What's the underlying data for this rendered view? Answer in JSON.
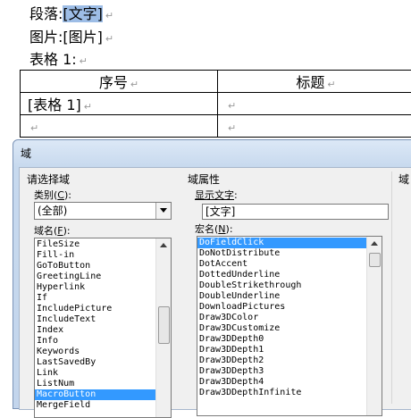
{
  "document": {
    "line1_label": "段落:",
    "line1_value": "[文字]",
    "line2": "图片:[图片]",
    "line3": "表格 1:",
    "paragraph_mark": "↵",
    "table": {
      "headers": [
        "序号",
        "标题"
      ],
      "rows": [
        [
          "[表格 1]",
          ""
        ],
        [
          "",
          ""
        ]
      ]
    }
  },
  "dialog": {
    "title": "域",
    "left_group": "请选择域",
    "category_label": "类别",
    "category_key": "C",
    "category_value": "(全部)",
    "field_names_label": "域名",
    "field_names_key": "F",
    "field_names": [
      "FileSize",
      "Fill-in",
      "GoToButton",
      "GreetingLine",
      "Hyperlink",
      "If",
      "IncludePicture",
      "IncludeText",
      "Index",
      "Info",
      "Keywords",
      "LastSavedBy",
      "Link",
      "ListNum",
      "MacroButton",
      "MergeField"
    ],
    "field_names_selected": 14,
    "right_group": "域属性",
    "display_text_label": "显示文字",
    "display_text_value": "[文字]",
    "macro_label": "宏名",
    "macro_key": "N",
    "macro_names": [
      "DoFieldClick",
      "DoNotDistribute",
      "DotAccent",
      "DottedUnderline",
      "DoubleStrikethrough",
      "DoubleUnderline",
      "DownloadPictures",
      "Draw3DColor",
      "Draw3DCustomize",
      "Draw3DDepth0",
      "Draw3DDepth1",
      "Draw3DDepth2",
      "Draw3DDepth3",
      "Draw3DDepth4",
      "Draw3DDepthInfinite"
    ],
    "macro_selected": 0,
    "third_group": "域"
  }
}
